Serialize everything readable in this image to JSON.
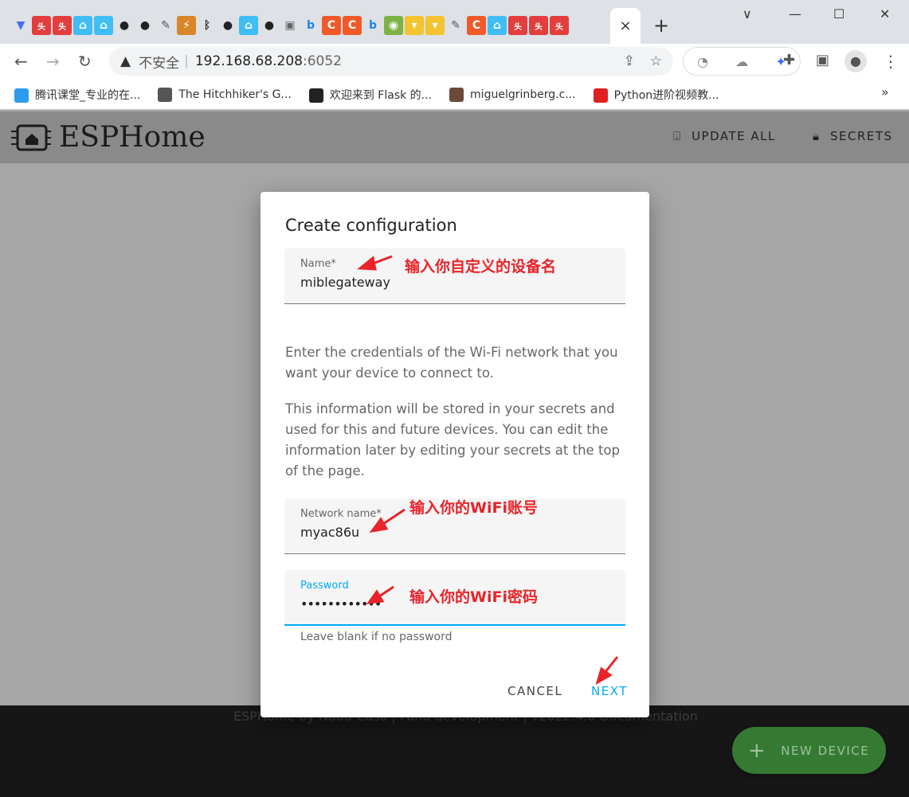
{
  "browser": {
    "tab_favicons": [
      "vue",
      "toutiao",
      "toutiao",
      "home-assistant",
      "home-assistant",
      "github",
      "github",
      "pen",
      "bolt",
      "bluetooth",
      "github",
      "home-assistant",
      "github",
      "camera",
      "bing",
      "csdn",
      "csdn",
      "bing",
      "code",
      "cup",
      "cup",
      "pen",
      "csdn",
      "home-assistant",
      "toutiao",
      "toutiao",
      "toutiao"
    ],
    "close_tab": "×",
    "new_tab": "+",
    "window": {
      "minimize": "—",
      "maximize": "☐",
      "close": "✕",
      "tabsearch": "∨"
    },
    "address": {
      "insecure_label": "不安全",
      "host": "192.168.68.208",
      "port": ":6052"
    },
    "bookmarks": [
      {
        "label": "腾讯课堂_专业的在...",
        "color": "#2c9cf0"
      },
      {
        "label": "The Hitchhiker's G...",
        "color": "#555555"
      },
      {
        "label": "欢迎来到 Flask 的...",
        "color": "#222222"
      },
      {
        "label": "miguelgrinberg.c...",
        "color": "#6b4a3a"
      },
      {
        "label": "Python进阶视频教...",
        "color": "#e02020"
      }
    ],
    "more_bookmarks": "»"
  },
  "app": {
    "title": "ESPHome",
    "update_all": "UPDATE ALL",
    "secrets": "SECRETS",
    "footer": "ESPHome by Nabu Casa | Fund development | v2022.4.0 Documentation",
    "new_device": "NEW DEVICE"
  },
  "dialog": {
    "title": "Create configuration",
    "name_label": "Name*",
    "name_value": "miblegateway",
    "para1": "Enter the credentials of the Wi-Fi network that you want your device to connect to.",
    "para2": "This information will be stored in your secrets and used for this and future devices. You can edit the information later by editing your secrets at the top of the page.",
    "network_label": "Network name*",
    "network_value": "myac86u",
    "password_label": "Password",
    "password_value": "••••••••••••",
    "password_helper": "Leave blank if no password",
    "cancel": "CANCEL",
    "next": "NEXT"
  },
  "annotations": {
    "name": "输入你自定义的设备名",
    "network": "输入你的WiFi账号",
    "password": "输入你的WiFi密码"
  },
  "colors": {
    "accent": "#03a9f4",
    "fab": "#357a32",
    "annotation": "#e8242a"
  }
}
